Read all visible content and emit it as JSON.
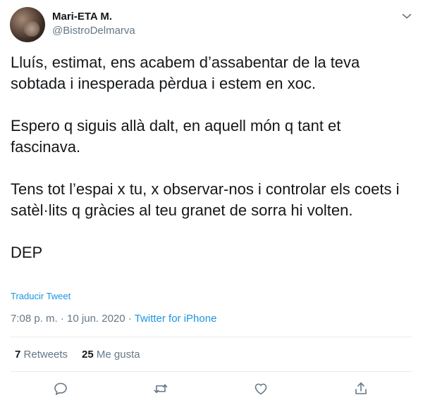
{
  "user": {
    "display_name": "Mari-ETA M.",
    "handle": "@BistroDelmarva"
  },
  "tweet": {
    "paragraphs": [
      "Lluís, estimat, ens acabem d’assabentar de la teva sobtada i inesperada pèrdua i estem en xoc.",
      "Espero q siguis allà dalt, en aquell món q tant et fascinava.",
      "Tens tot l’espai x tu, x observar-nos i controlar els coets i satèl·lits q gràcies al teu granet de sorra hi volten.",
      "DEP"
    ],
    "translate_label": "Traducir Tweet",
    "time": "7:08 p. m.",
    "date": "10 jun. 2020",
    "separator": "·",
    "source": "Twitter for iPhone"
  },
  "stats": {
    "retweets_count": "7",
    "retweets_label": "Retweets",
    "likes_count": "25",
    "likes_label": "Me gusta"
  },
  "icons": {
    "caret": "chevron-down-icon",
    "reply": "reply-icon",
    "retweet": "retweet-icon",
    "like": "heart-icon",
    "share": "share-icon"
  },
  "colors": {
    "text": "#14171a",
    "secondary": "#657786",
    "link": "#1b95e0",
    "divider": "#e6ecf0"
  }
}
